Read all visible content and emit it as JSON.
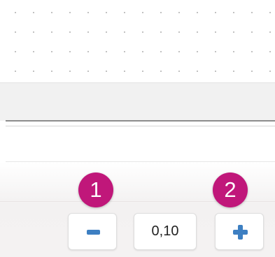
{
  "stepper": {
    "value": "0,10",
    "decrement_icon": "minus-icon",
    "increment_icon": "plus-icon",
    "icon_color": "#3d7fc2"
  },
  "callouts": [
    {
      "label": "1",
      "color": "#c0177a"
    },
    {
      "label": "2",
      "color": "#c0177a"
    }
  ]
}
